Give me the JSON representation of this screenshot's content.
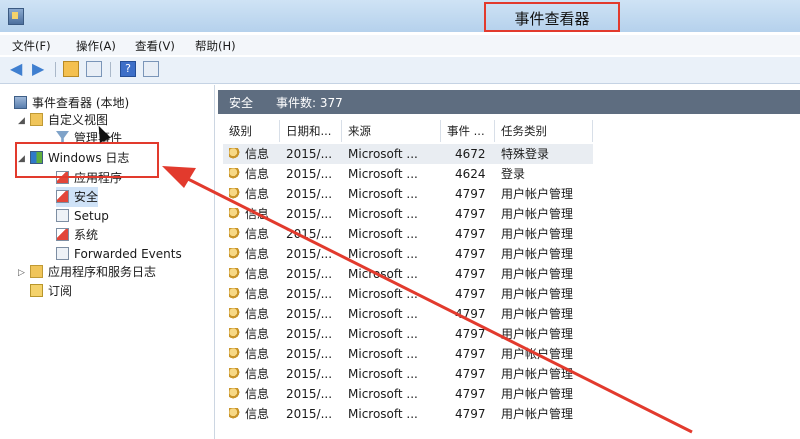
{
  "window": {
    "title": "事件查看器"
  },
  "menu": [
    "文件(F)",
    "操作(A)",
    "查看(V)",
    "帮助(H)"
  ],
  "toolbar": {
    "icons": [
      "back-arrow-icon",
      "forward-arrow-icon",
      "up-folder-icon",
      "show-hide-tree-icon",
      "help-icon",
      "properties-icon"
    ]
  },
  "tree": {
    "root": "事件查看器 (本地)",
    "custom_views": "自定义视图",
    "admin_events": "管理事件",
    "windows_logs": "Windows 日志",
    "logs": [
      "应用程序",
      "安全",
      "Setup",
      "系统",
      "Forwarded Events"
    ],
    "app_service_logs": "应用程序和服务日志",
    "subscriptions": "订阅"
  },
  "panel": {
    "log_name": "安全",
    "event_count": "事件数: 377"
  },
  "table": {
    "columns": [
      "级别",
      "日期和...",
      "来源",
      "事件 ...",
      "任务类别"
    ],
    "rows": [
      {
        "level": "信息",
        "date": "2015/...",
        "source": "Microsoft ...",
        "id": "4672",
        "category": "特殊登录"
      },
      {
        "level": "信息",
        "date": "2015/...",
        "source": "Microsoft ...",
        "id": "4624",
        "category": "登录"
      },
      {
        "level": "信息",
        "date": "2015/...",
        "source": "Microsoft ...",
        "id": "4797",
        "category": "用户帐户管理"
      },
      {
        "level": "信息",
        "date": "2015/...",
        "source": "Microsoft ...",
        "id": "4797",
        "category": "用户帐户管理"
      },
      {
        "level": "信息",
        "date": "2015/...",
        "source": "Microsoft ...",
        "id": "4797",
        "category": "用户帐户管理"
      },
      {
        "level": "信息",
        "date": "2015/...",
        "source": "Microsoft ...",
        "id": "4797",
        "category": "用户帐户管理"
      },
      {
        "level": "信息",
        "date": "2015/...",
        "source": "Microsoft ...",
        "id": "4797",
        "category": "用户帐户管理"
      },
      {
        "level": "信息",
        "date": "2015/...",
        "source": "Microsoft ...",
        "id": "4797",
        "category": "用户帐户管理"
      },
      {
        "level": "信息",
        "date": "2015/...",
        "source": "Microsoft ...",
        "id": "4797",
        "category": "用户帐户管理"
      },
      {
        "level": "信息",
        "date": "2015/...",
        "source": "Microsoft ...",
        "id": "4797",
        "category": "用户帐户管理"
      },
      {
        "level": "信息",
        "date": "2015/...",
        "source": "Microsoft ...",
        "id": "4797",
        "category": "用户帐户管理"
      },
      {
        "level": "信息",
        "date": "2015/...",
        "source": "Microsoft ...",
        "id": "4797",
        "category": "用户帐户管理"
      },
      {
        "level": "信息",
        "date": "2015/...",
        "source": "Microsoft ...",
        "id": "4797",
        "category": "用户帐户管理"
      },
      {
        "level": "信息",
        "date": "2015/...",
        "source": "Microsoft ...",
        "id": "4797",
        "category": "用户帐户管理"
      }
    ]
  },
  "colors": {
    "annotation": "#e23a2d",
    "header_bar": "#5e6d80"
  }
}
